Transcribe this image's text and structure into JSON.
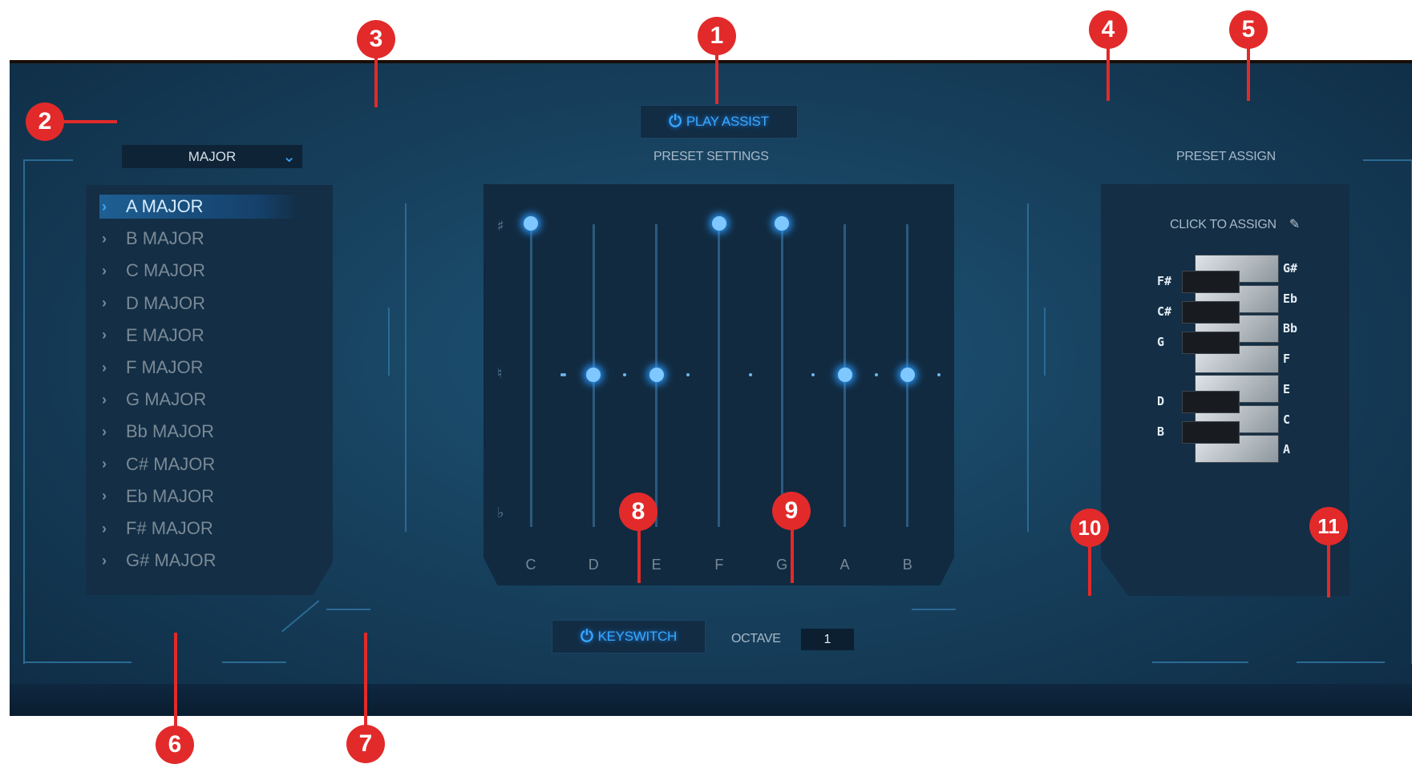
{
  "play_assist": {
    "label": "PLAY ASSIST",
    "power_glyph": "⏻"
  },
  "preset_settings_title": "PRESET SETTINGS",
  "preset_assign_title": "PRESET ASSIGN",
  "scale_dropdown": {
    "value": "MAJOR",
    "chevron": "⌄"
  },
  "scale_list": [
    {
      "label": "A MAJOR",
      "selected": true
    },
    {
      "label": "B MAJOR"
    },
    {
      "label": "C MAJOR"
    },
    {
      "label": "D MAJOR"
    },
    {
      "label": "E MAJOR"
    },
    {
      "label": "F MAJOR"
    },
    {
      "label": "G MAJOR"
    },
    {
      "label": "Bb MAJOR"
    },
    {
      "label": "C# MAJOR"
    },
    {
      "label": "Eb MAJOR"
    },
    {
      "label": "F# MAJOR"
    },
    {
      "label": "G# MAJOR"
    }
  ],
  "list_arrow": "›",
  "accidentals": {
    "sharp": "♯",
    "natural": "♮",
    "flat": "♭"
  },
  "notes": [
    {
      "name": "C",
      "state": "sharp"
    },
    {
      "name": "D",
      "state": "natural"
    },
    {
      "name": "E",
      "state": "natural"
    },
    {
      "name": "F",
      "state": "sharp"
    },
    {
      "name": "G",
      "state": "sharp"
    },
    {
      "name": "A",
      "state": "natural"
    },
    {
      "name": "B",
      "state": "natural"
    }
  ],
  "click_to_assign": "CLICK TO ASSIGN",
  "pencil_icon": "✎",
  "keyboard_left_labels": [
    "F#",
    "C#",
    "G",
    "D",
    "B"
  ],
  "keyboard_right_labels": [
    "G#",
    "Eb",
    "Bb",
    "F",
    "E",
    "C",
    "A"
  ],
  "keyswitch": {
    "label": "KEYSWITCH",
    "power_glyph": "⏻"
  },
  "octave": {
    "label": "OCTAVE",
    "value": "1"
  },
  "callouts": [
    "1",
    "2",
    "3",
    "4",
    "5",
    "6",
    "7",
    "8",
    "9",
    "10",
    "11"
  ],
  "colors": {
    "accent": "#3aa8ff",
    "callout": "#e22a2a",
    "panel": "#17415e"
  }
}
